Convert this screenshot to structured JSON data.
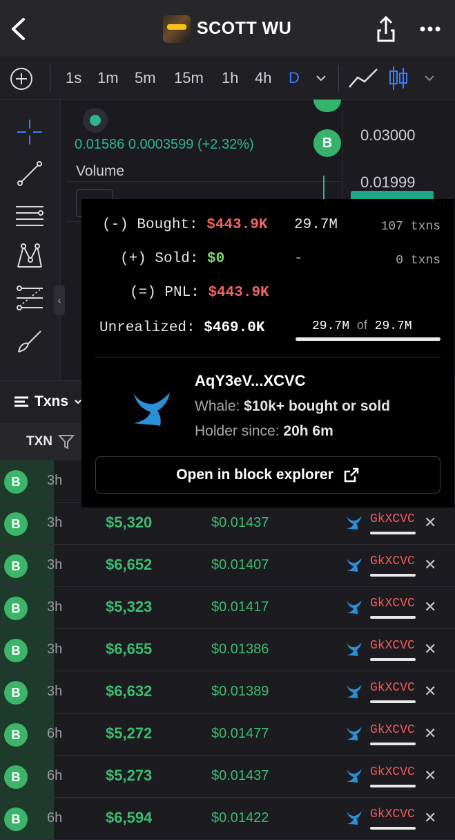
{
  "header": {
    "title": "SCOTT WU"
  },
  "timeframes": {
    "items": [
      "1s",
      "1m",
      "5m",
      "15m",
      "1h",
      "4h",
      "D"
    ],
    "active": "D"
  },
  "chart": {
    "price_line": "0.01586 0.0003599 (+2.32%)",
    "volume_label": "Volume",
    "axis": [
      "0.03000",
      "0.01999"
    ],
    "marker_label": "B"
  },
  "txns": {
    "tab_label": "Txns",
    "col_txn": "TXN",
    "rows": [
      {
        "type": "B",
        "age": "3h",
        "amount": "",
        "price": "",
        "maker": ""
      },
      {
        "type": "B",
        "age": "3h",
        "amount": "$5,320",
        "price": "$0.01437",
        "maker": "GkXCVC"
      },
      {
        "type": "B",
        "age": "3h",
        "amount": "$6,652",
        "price": "$0.01407",
        "maker": "GkXCVC"
      },
      {
        "type": "B",
        "age": "3h",
        "amount": "$5,323",
        "price": "$0.01417",
        "maker": "GkXCVC"
      },
      {
        "type": "B",
        "age": "3h",
        "amount": "$6,655",
        "price": "$0.01386",
        "maker": "GkXCVC"
      },
      {
        "type": "B",
        "age": "3h",
        "amount": "$6,632",
        "price": "$0.01389",
        "maker": "GkXCVC"
      },
      {
        "type": "B",
        "age": "6h",
        "amount": "$5,272",
        "price": "$0.01477",
        "maker": "GkXCVC"
      },
      {
        "type": "B",
        "age": "6h",
        "amount": "$5,273",
        "price": "$0.01437",
        "maker": "GkXCVC"
      },
      {
        "type": "B",
        "age": "6h",
        "amount": "$6,594",
        "price": "$0.01422",
        "maker": "GkXCVC"
      }
    ]
  },
  "popup": {
    "bought_label": "(-) Bought:",
    "bought_value": "$443.9K",
    "bought_tokens": "29.7M",
    "bought_txns": "107 txns",
    "sold_label": "(+) Sold:",
    "sold_value": "$0",
    "sold_tokens": "-",
    "sold_txns": "0 txns",
    "pnl_label": "(=) PNL:",
    "pnl_value": "$443.9K",
    "unrealized_label": "Unrealized:",
    "unrealized_value": "$469.0K",
    "holding_amount": "29.7M",
    "holding_of": "of",
    "holding_total": "29.7M",
    "address": "AqY3eV...XCVC",
    "whale_label": "Whale:",
    "whale_desc": "$10k+ bought or sold",
    "holder_label": "Holder since:",
    "holder_value": "20h 6m",
    "explorer_button": "Open in block explorer"
  },
  "colors": {
    "buy_green": "#3dbb6f",
    "sell_red": "#f26464",
    "accent_blue": "#3b7cff",
    "whale_blue": "#2a8fd6"
  }
}
